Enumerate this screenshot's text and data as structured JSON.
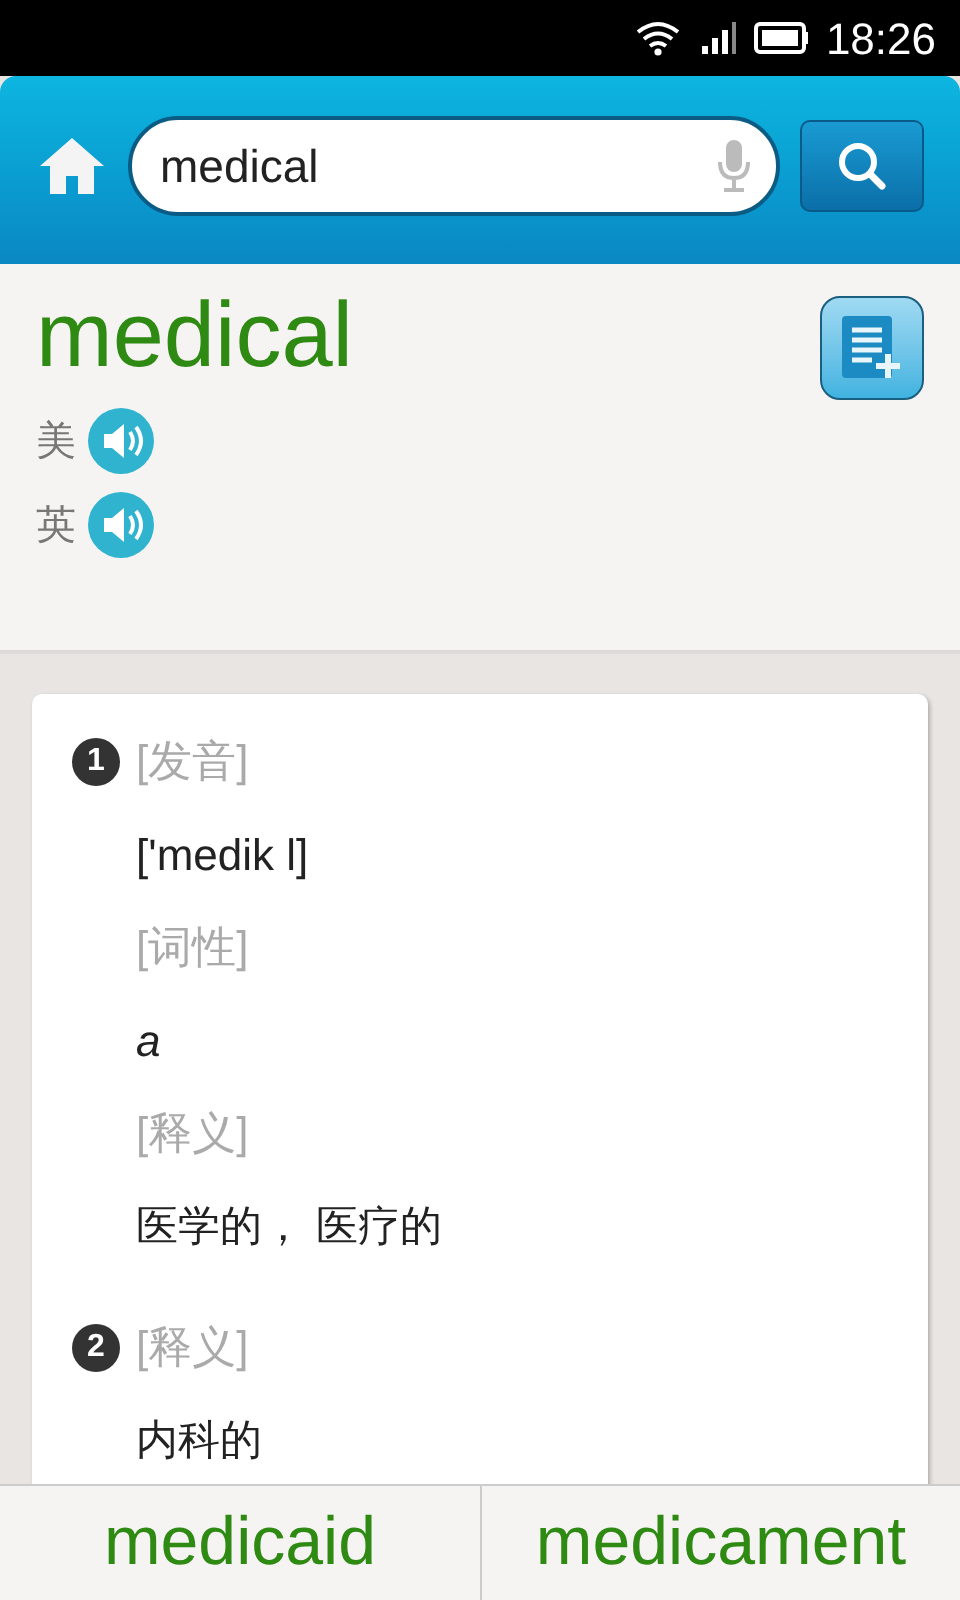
{
  "status_bar": {
    "time": "18:26"
  },
  "search": {
    "value": "medical"
  },
  "entry": {
    "headword": "medical",
    "pronunciations": [
      {
        "label": "美"
      },
      {
        "label": "英"
      }
    ]
  },
  "senses": [
    {
      "number": "1",
      "fields": [
        {
          "label": "[发音]",
          "value": "['medik l]",
          "kind": "phonetic"
        },
        {
          "label": "[词性]",
          "value": "a",
          "kind": "pos"
        },
        {
          "label": "[释义]",
          "value": "医学的， 医疗的",
          "kind": "meaning"
        }
      ]
    },
    {
      "number": "2",
      "fields": [
        {
          "label": "[释义]",
          "value": "内科的",
          "kind": "meaning"
        }
      ]
    }
  ],
  "related_words": [
    "medicaid",
    "medicament"
  ]
}
